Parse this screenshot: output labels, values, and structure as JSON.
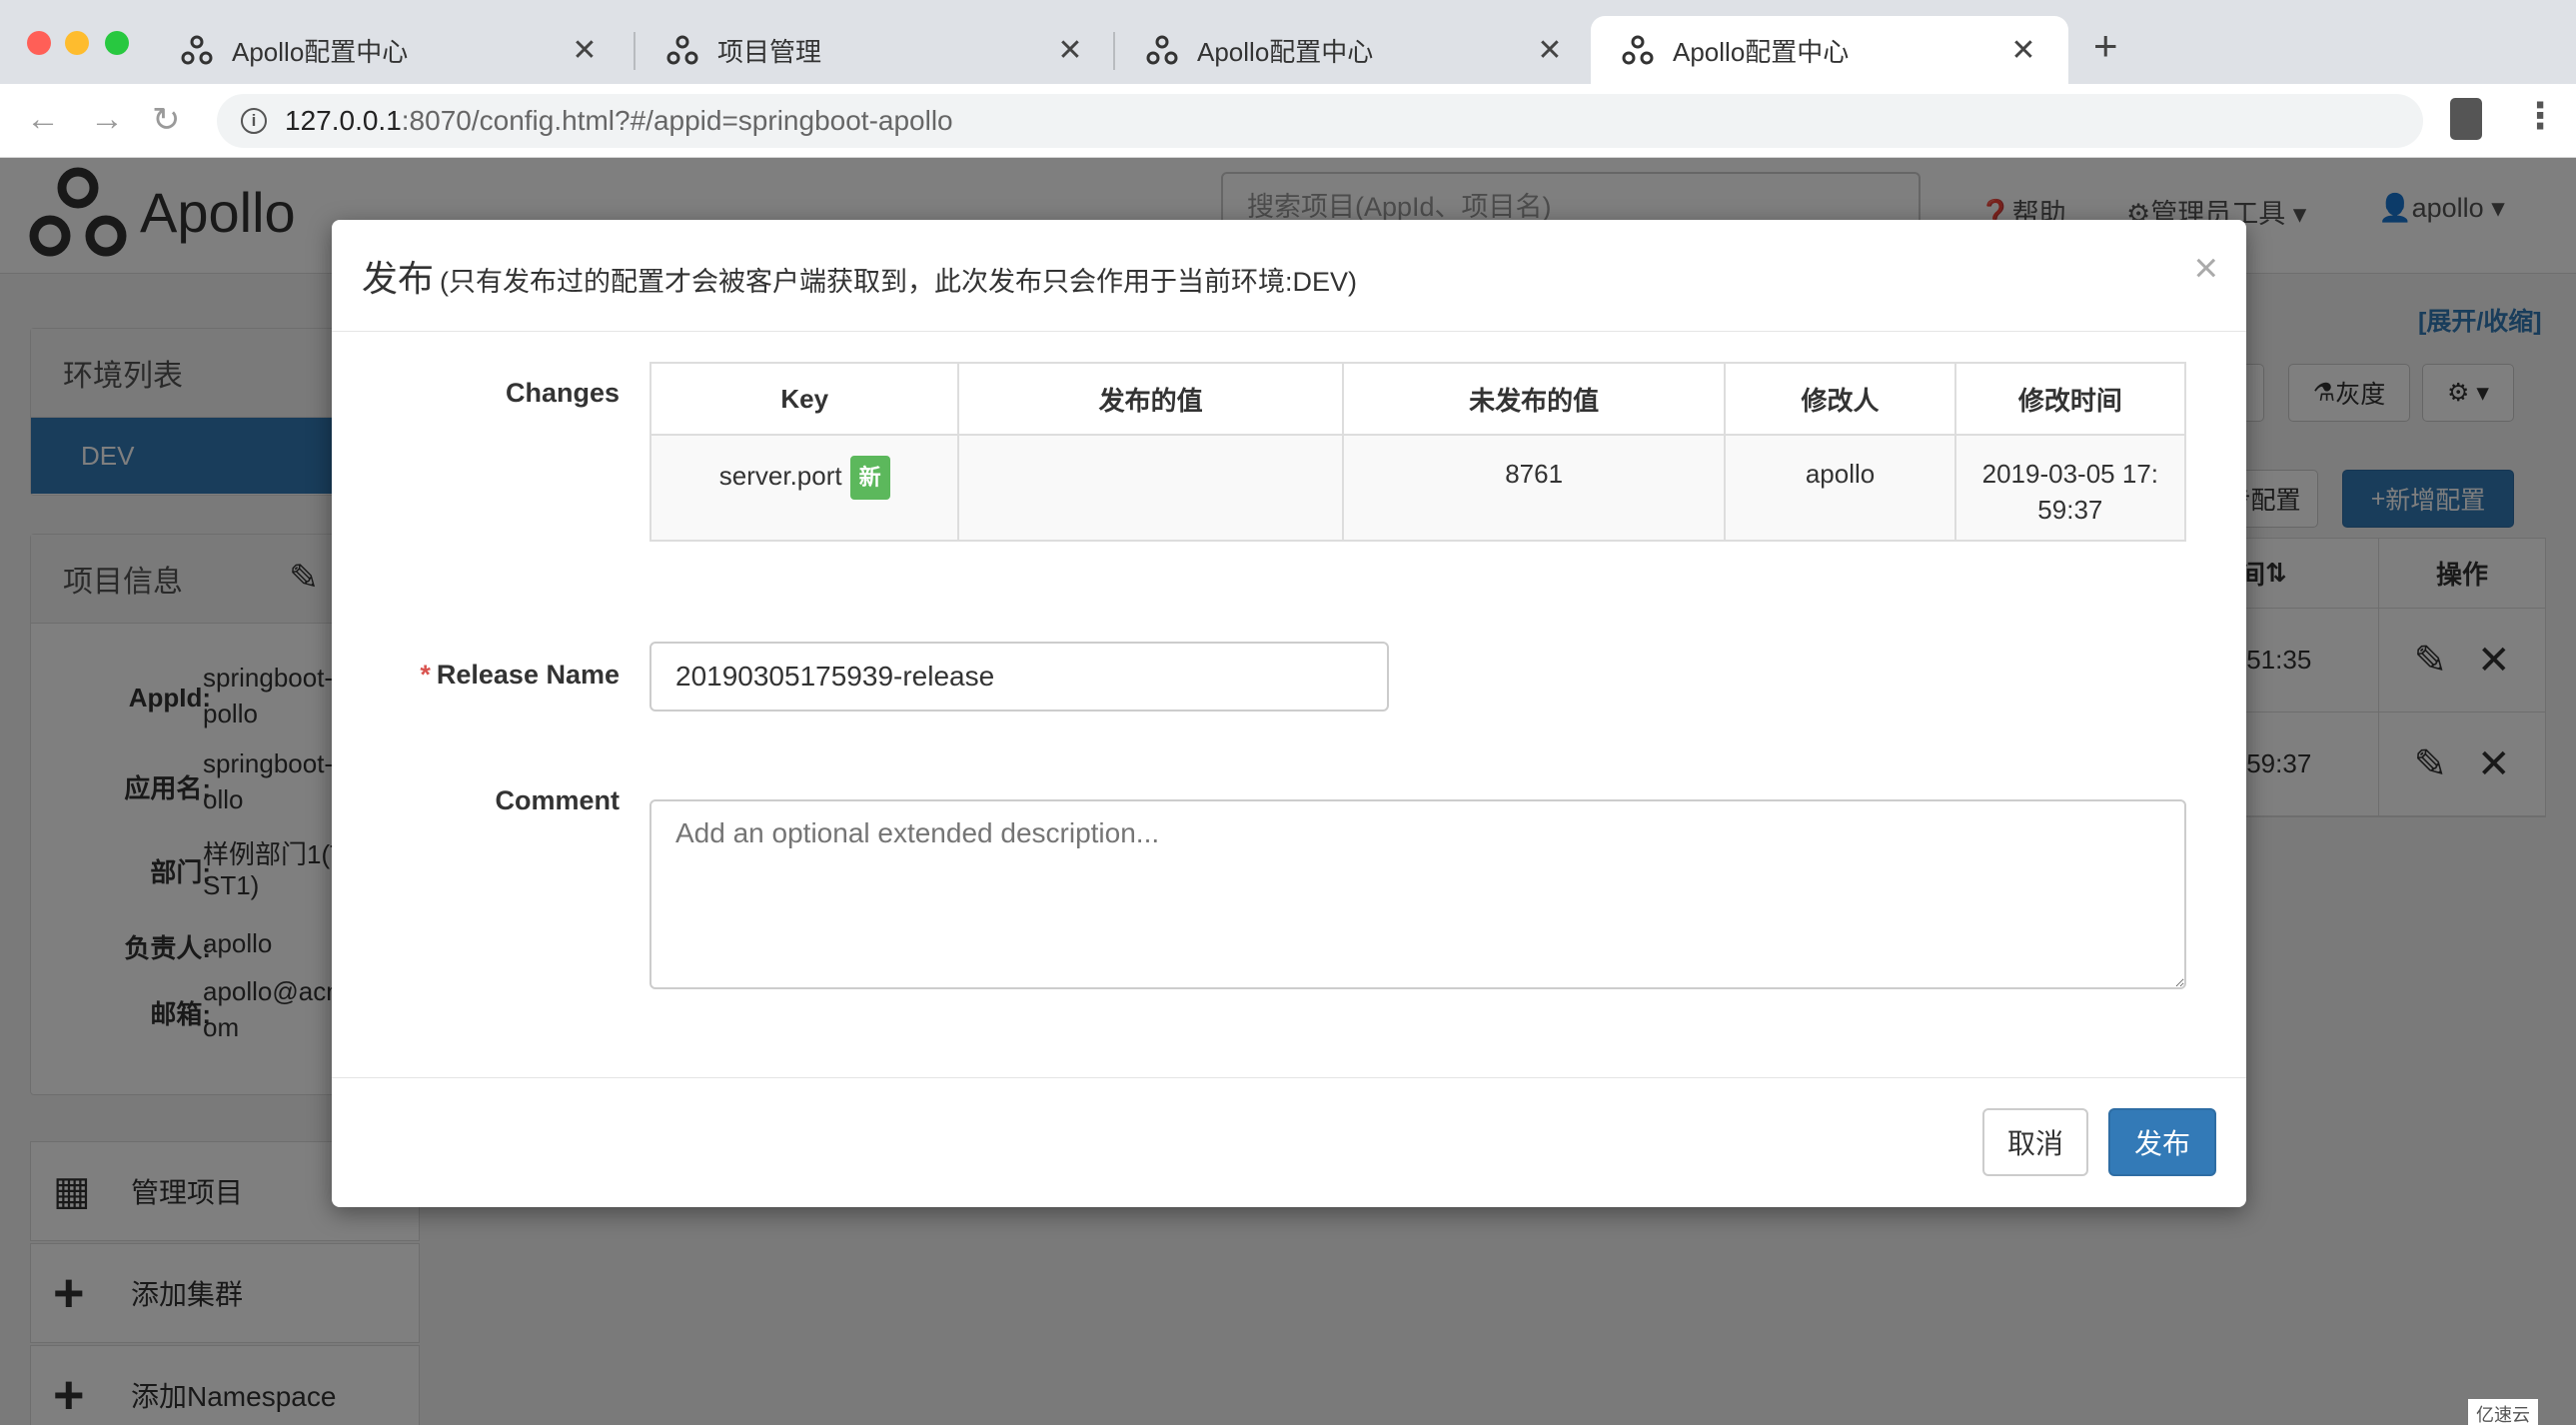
{
  "browser": {
    "tabs": [
      {
        "title": "Apollo配置中心"
      },
      {
        "title": "项目管理"
      },
      {
        "title": "Apollo配置中心"
      },
      {
        "title": "Apollo配置中心"
      }
    ],
    "close_glyph": "✕",
    "new_tab_glyph": "+",
    "url_host": "127.0.0.1",
    "url_rest": ":8070/config.html?#/appid=springboot-apollo"
  },
  "header": {
    "logo_text": "Apollo",
    "search_placeholder": "搜索项目(AppId、项目名)",
    "help": "帮助",
    "admin_tools": "管理员工具",
    "user": "apollo"
  },
  "sidebar": {
    "env_title": "环境列表",
    "env_item": "DEV",
    "project_title": "项目信息",
    "info": [
      {
        "label": "AppId:",
        "value": "springboot-a",
        "value2": "pollo"
      },
      {
        "label": "应用名:",
        "value": "springboot-",
        "value2": "ollo"
      },
      {
        "label": "部门:",
        "value": "样例部门1(T",
        "value2": "ST1)"
      },
      {
        "label": "负责人:",
        "value": "apollo",
        "value2": ""
      },
      {
        "label": "邮箱:",
        "value": "apollo@acm",
        "value2": "om"
      }
    ],
    "actions": [
      {
        "label": "管理项目"
      },
      {
        "label": "添加集群"
      },
      {
        "label": "添加Namespace"
      }
    ]
  },
  "main": {
    "expand_link": "[展开/收缩]",
    "btn_gray": "灰度",
    "btn_sync": "步配置",
    "btn_add": "新增配置",
    "btn_partial": "X",
    "table_head_time": "间",
    "table_head_ops": "操作",
    "rows": [
      {
        "time": ":51:35"
      },
      {
        "time": ":59:37"
      }
    ]
  },
  "modal": {
    "title": "发布",
    "subtitle": "(只有发布过的配置才会被客户端获取到，此次发布只会作用于当前环境:DEV)",
    "close": "×",
    "changes_label": "Changes",
    "columns": [
      "Key",
      "发布的值",
      "未发布的值",
      "修改人",
      "修改时间"
    ],
    "rows": [
      {
        "key": "server.port",
        "badge": "新",
        "released": "",
        "unreleased": "8761",
        "modifier": "apollo",
        "time_line1": "2019-03-05 17:",
        "time_line2": "59:37"
      }
    ],
    "required_mark": "*",
    "release_name_label": "Release Name",
    "release_name_value": "20190305175939-release",
    "comment_label": "Comment",
    "comment_placeholder": "Add an optional extended description...",
    "cancel": "取消",
    "publish": "发布"
  },
  "watermark": "亿速云"
}
